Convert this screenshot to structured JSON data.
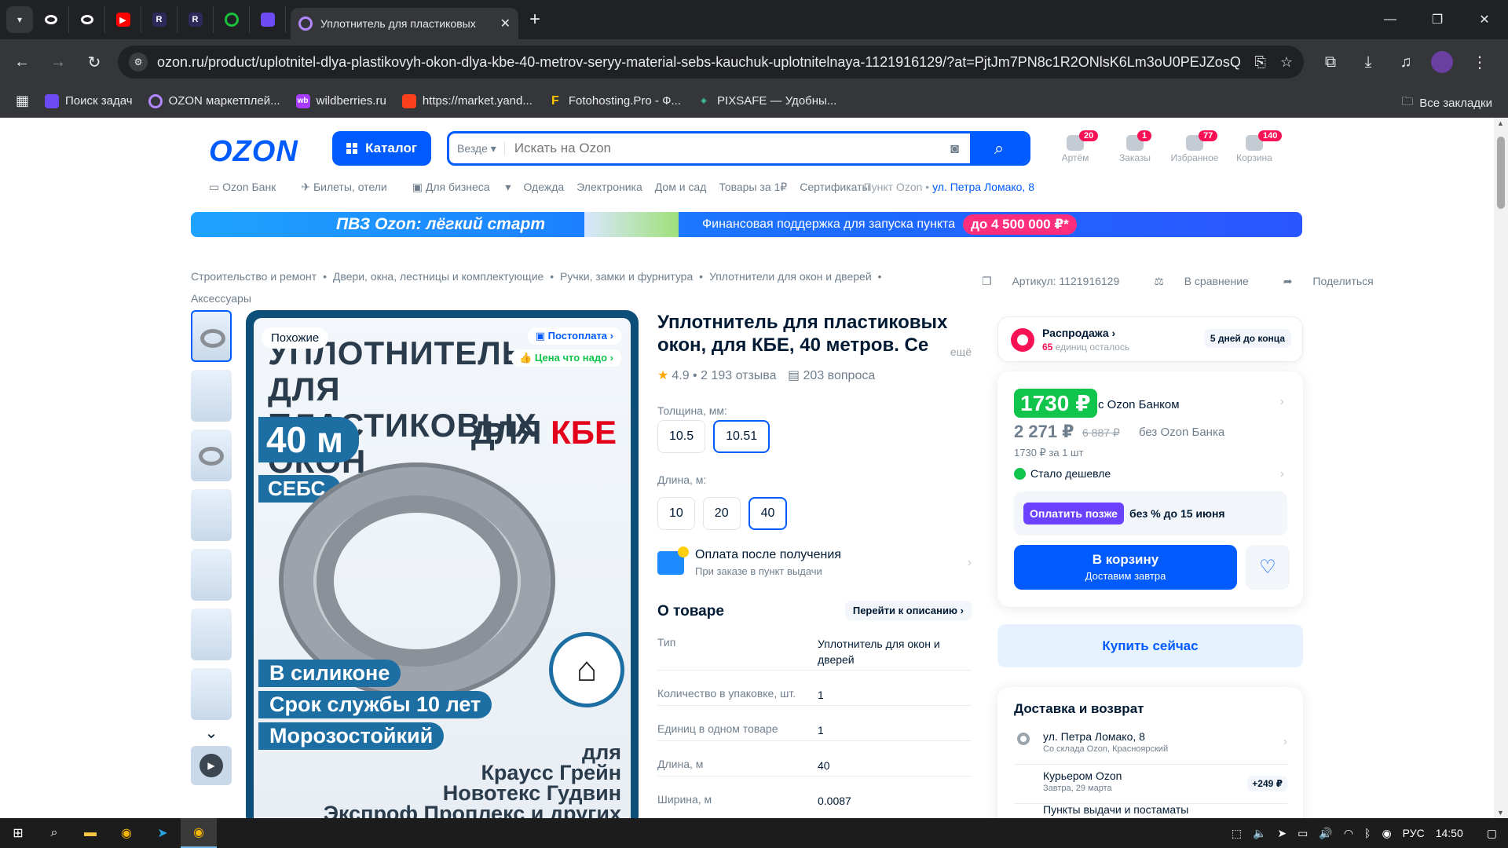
{
  "browser": {
    "active_tab_title": "Уплотнитель для пластиковых",
    "url": "ozon.ru/product/uplotnitel-dlya-plastikovyh-okon-dlya-kbe-40-metrov-seryy-material-sebs-kauchuk-uplotnitelnaya-1121916129/?at=PjtJm7PN8c1R2ONlsK6Lm3oU0PEJZosQx...",
    "bookmarks": [
      "Поиск задач",
      "OZON маркетплей...",
      "wildberries.ru",
      "https://market.yand...",
      "Fotohosting.Pro - Ф...",
      "PIXSAFE — Удобны..."
    ],
    "all_bookmarks": "Все закладки"
  },
  "header": {
    "logo": "OZON",
    "catalog": "Каталог",
    "search_scope": "Везде",
    "search_placeholder": "Искать на Ozon",
    "icons": [
      {
        "label": "Артём",
        "badge": "20"
      },
      {
        "label": "Заказы",
        "badge": "1"
      },
      {
        "label": "Избранное",
        "badge": "77"
      },
      {
        "label": "Корзина",
        "badge": "140"
      }
    ],
    "subnav": [
      "Ozon Банк",
      "Билеты, отели",
      "Для бизнеса",
      "Одежда",
      "Электроника",
      "Дом и сад",
      "Товары за 1₽",
      "Сертификаты"
    ],
    "pickup_label": "Пункт Ozon •",
    "pickup_address": "ул. Петра Ломако, 8"
  },
  "banner": {
    "title": "ПВЗ Ozon: лёгкий старт",
    "text": "Финансовая поддержка для запуска пункта",
    "amount": "до 4 500 000 ₽*"
  },
  "breadcrumbs": [
    "Строительство и ремонт",
    "•",
    "Двери, окна, лестницы и комплектующие",
    "•",
    "Ручки, замки и фурнитура",
    "•",
    "Уплотнители для окон и дверей",
    "•",
    "Аксессуары"
  ],
  "article": {
    "sku": "Артикул: 1121916129",
    "compare": "В сравнение",
    "share": "Поделиться"
  },
  "gallery": {
    "similar": "Похожие",
    "postpay": "Постоплата",
    "fair_price": "Цена что надо",
    "img_title": "УПЛОТНИТЕЛЬ ДЛЯ ПЛАСТИКОВЫХ ОКОН",
    "img_for": "ДЛЯ",
    "img_brand": "КБЕ",
    "img_length": "40 м",
    "img_material": "СЕБС",
    "img_feature1": "В силиконе",
    "img_feature2": "Срок службы 10 лет",
    "img_feature3": "Морозостойкий",
    "img_brands": [
      "для",
      "Краусс Грейн",
      "Новотекс Гудвин",
      "Экспроф Проплекс и других"
    ]
  },
  "product": {
    "title_line1": "Уплотнитель для пластиковых",
    "title_line2": "окон, для КБЕ, 40 метров. Се",
    "more": "ещё",
    "rating": "4.9 • 2 193 отзыва",
    "questions": "203 вопроса",
    "thickness_label": "Толщина, мм:",
    "thickness_options": [
      "10.5",
      "10.51"
    ],
    "length_label": "Длина, м:",
    "length_options": [
      "10",
      "20",
      "40"
    ],
    "pay_after": "Оплата после получения",
    "pay_after_sub": "При заказе в пункт выдачи",
    "about": "О товаре",
    "goto_desc": "Перейти к описанию",
    "specs": [
      {
        "k": "Тип",
        "v": "Уплотнитель для окон и дверей"
      },
      {
        "k": "Количество в упаковке, шт.",
        "v": "1"
      },
      {
        "k": "Единиц в одном товаре",
        "v": "1"
      },
      {
        "k": "Длина, м",
        "v": "40"
      },
      {
        "k": "Ширина, м",
        "v": "0.0087"
      }
    ]
  },
  "sale": {
    "title": "Распродажа",
    "left_count": "65",
    "left_text": "единиц осталось",
    "days": "5 дней до конца"
  },
  "price": {
    "bank_price": "1730 ₽",
    "with_bank": "с Ozon Банком",
    "regular": "2 271 ₽",
    "old": "6 887 ₽",
    "without_bank": "без Ozon Банка",
    "per_unit": "1730 ₽ за 1 шт",
    "cheaper": "Стало дешевле",
    "pay_later_btn": "Оплатить позже",
    "pay_later_text": "без % до 15 июня",
    "cart": "В корзину",
    "cart_sub": "Доставим завтра",
    "buy_now": "Купить сейчас"
  },
  "delivery": {
    "title": "Доставка и возврат",
    "rows": [
      {
        "t": "ул. Петра Ломако, 8",
        "s": "Со склада Ozon, Красноярский"
      },
      {
        "t": "Курьером Ozon",
        "s": "Завтра, 29 марта",
        "price": "+249 ₽"
      },
      {
        "t": "Пункты выдачи и постаматы",
        "s": ""
      }
    ]
  },
  "taskbar": {
    "lang": "РУС",
    "time": "14:50"
  }
}
